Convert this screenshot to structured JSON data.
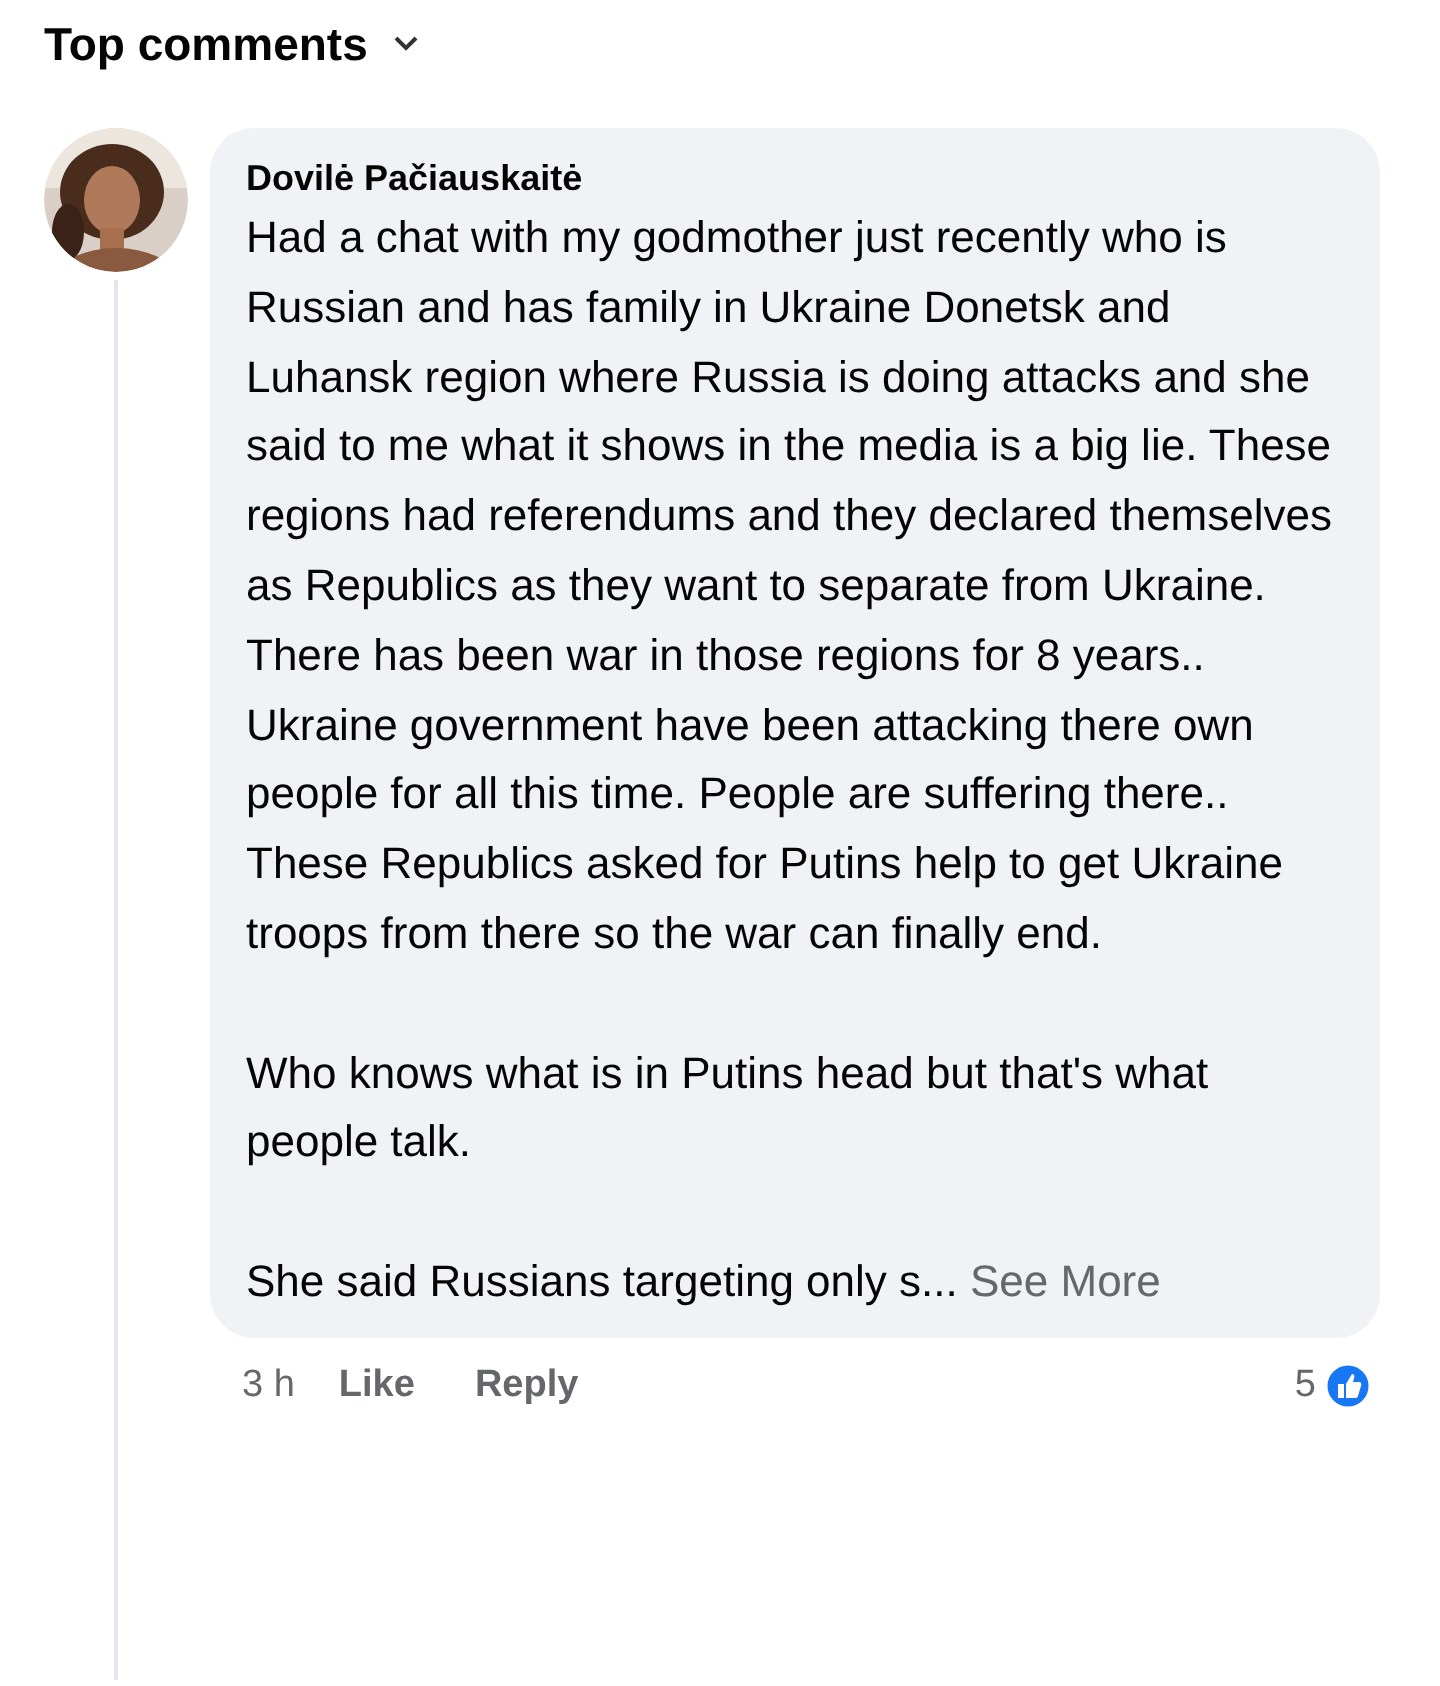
{
  "header": {
    "title": "Top comments"
  },
  "comment": {
    "author": "Dovilė Pačiauskaitė",
    "paragraphs": [
      "Had a chat with my godmother just recently who is Russian and has family in Ukraine Donetsk and Luhansk region where Russia is doing attacks and she said to me what it shows in the media is a big lie. These regions had referendums and they declared themselves as Republics as they want to separate from Ukraine. There has been war in those regions for 8 years.. Ukraine government have been attacking there own people for all this time. People are suffering there.. These Republics asked for Putins help to get Ukraine troops from there so the war can finally end.",
      "Who knows what is in Putins head but that's what people talk.",
      "She said Russians targeting only s..."
    ],
    "see_more": "See More",
    "time": "3 h",
    "actions": [
      "Like",
      "Reply"
    ],
    "reactions": "5"
  }
}
